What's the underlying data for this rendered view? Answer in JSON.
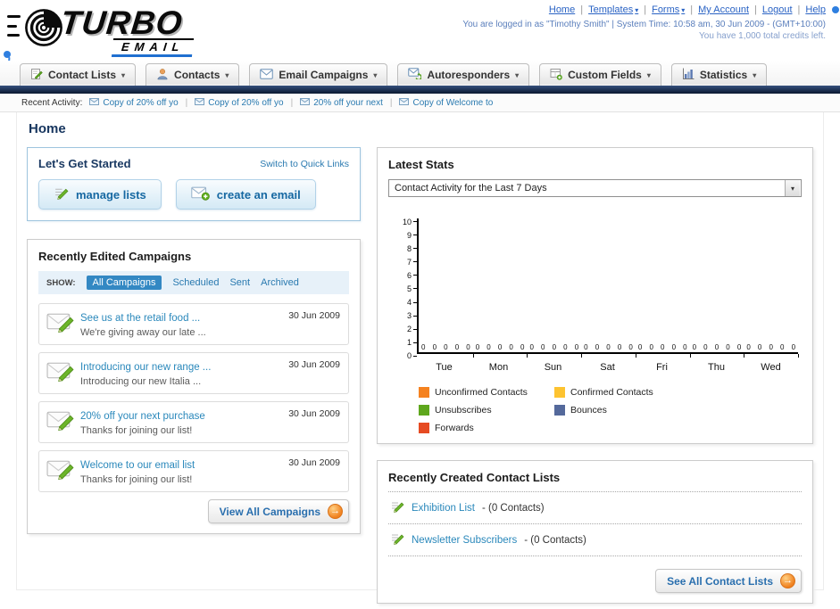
{
  "logo": {
    "primary": "TURBO",
    "secondary": "EMAIL"
  },
  "icons": {
    "dropdown_arrow": "▾",
    "arrow_right": "→"
  },
  "topbar": {
    "links": [
      {
        "label": "Home",
        "dropdown": false
      },
      {
        "label": "Templates",
        "dropdown": true
      },
      {
        "label": "Forms",
        "dropdown": true
      },
      {
        "label": "My Account",
        "dropdown": false
      },
      {
        "label": "Logout",
        "dropdown": false
      },
      {
        "label": "Help",
        "dropdown": false
      }
    ],
    "login_info": "You are logged in as \"Timothy Smith\" | System Time: 10:58 am, 30 Jun 2009 - (GMT+10:00)",
    "credits_info": "You have 1,000 total credits left."
  },
  "nav": {
    "tabs": [
      {
        "label": "Contact Lists",
        "icon": "contact-lists-icon"
      },
      {
        "label": "Contacts",
        "icon": "contacts-icon"
      },
      {
        "label": "Email Campaigns",
        "icon": "email-campaigns-icon"
      },
      {
        "label": "Autoresponders",
        "icon": "autoresponders-icon"
      },
      {
        "label": "Custom Fields",
        "icon": "custom-fields-icon"
      },
      {
        "label": "Statistics",
        "icon": "statistics-icon"
      }
    ]
  },
  "recent_activity": {
    "label": "Recent Activity:",
    "items": [
      {
        "label": "Copy of 20% off yo"
      },
      {
        "label": "Copy of 20% off yo"
      },
      {
        "label": "20% off your next"
      },
      {
        "label": "Copy of Welcome to"
      }
    ]
  },
  "page": {
    "title": "Home"
  },
  "get_started": {
    "title": "Let's Get Started",
    "switch_link": "Switch to Quick Links",
    "manage_lists_button": "manage lists",
    "create_email_button": "create an email"
  },
  "campaigns": {
    "title": "Recently Edited Campaigns",
    "show_label": "SHOW:",
    "filters": [
      "All Campaigns",
      "Scheduled",
      "Sent",
      "Archived"
    ],
    "active_filter": "All Campaigns",
    "rows": [
      {
        "title": "See us at the retail food ...",
        "subtitle": "We're giving away our late ...",
        "date": "30 Jun 2009"
      },
      {
        "title": "Introducing our new range ...",
        "subtitle": "Introducing our new Italia ...",
        "date": "30 Jun 2009"
      },
      {
        "title": "20% off your next purchase",
        "subtitle": "Thanks for joining our list!",
        "date": "30 Jun 2009"
      },
      {
        "title": "Welcome to our email list",
        "subtitle": "Thanks for joining our list!",
        "date": "30 Jun 2009"
      }
    ],
    "view_all_button": "View All Campaigns"
  },
  "stats": {
    "title": "Latest Stats",
    "period_selected": "Contact Activity for the Last 7 Days",
    "legend": [
      {
        "label": "Unconfirmed Contacts",
        "color": "#F58220"
      },
      {
        "label": "Confirmed Contacts",
        "color": "#FDC330"
      },
      {
        "label": "Unsubscribes",
        "color": "#5EA71D"
      },
      {
        "label": "Bounces",
        "color": "#54699B"
      },
      {
        "label": "Forwards",
        "color": "#E64B22"
      }
    ]
  },
  "chart_data": {
    "type": "bar",
    "title": "Contact Activity for the Last 7 Days",
    "categories": [
      "Tue",
      "Mon",
      "Sun",
      "Sat",
      "Fri",
      "Thu",
      "Wed"
    ],
    "series": [
      {
        "name": "Unconfirmed Contacts",
        "color": "#F58220",
        "values": [
          0,
          0,
          0,
          0,
          0,
          0,
          0
        ]
      },
      {
        "name": "Confirmed Contacts",
        "color": "#FDC330",
        "values": [
          0,
          0,
          0,
          0,
          0,
          0,
          0
        ]
      },
      {
        "name": "Unsubscribes",
        "color": "#5EA71D",
        "values": [
          0,
          0,
          0,
          0,
          0,
          0,
          0
        ]
      },
      {
        "name": "Bounces",
        "color": "#54699B",
        "values": [
          0,
          0,
          0,
          0,
          0,
          0,
          0
        ]
      },
      {
        "name": "Forwards",
        "color": "#E64B22",
        "values": [
          0,
          0,
          0,
          0,
          0,
          0,
          0
        ]
      }
    ],
    "ylim": [
      0,
      10
    ],
    "yticks": [
      10,
      9,
      8,
      7,
      6,
      5,
      4,
      3,
      2,
      1,
      0
    ],
    "grid": false,
    "legend_position": "bottom",
    "value_labels_shown": true
  },
  "contact_lists": {
    "title": "Recently Created Contact Lists",
    "items": [
      {
        "name": "Exhibition List",
        "suffix": "- (0 Contacts)"
      },
      {
        "name": "Newsletter Subscribers",
        "suffix": "- (0 Contacts)"
      }
    ],
    "see_all_button": "See All Contact Lists"
  }
}
